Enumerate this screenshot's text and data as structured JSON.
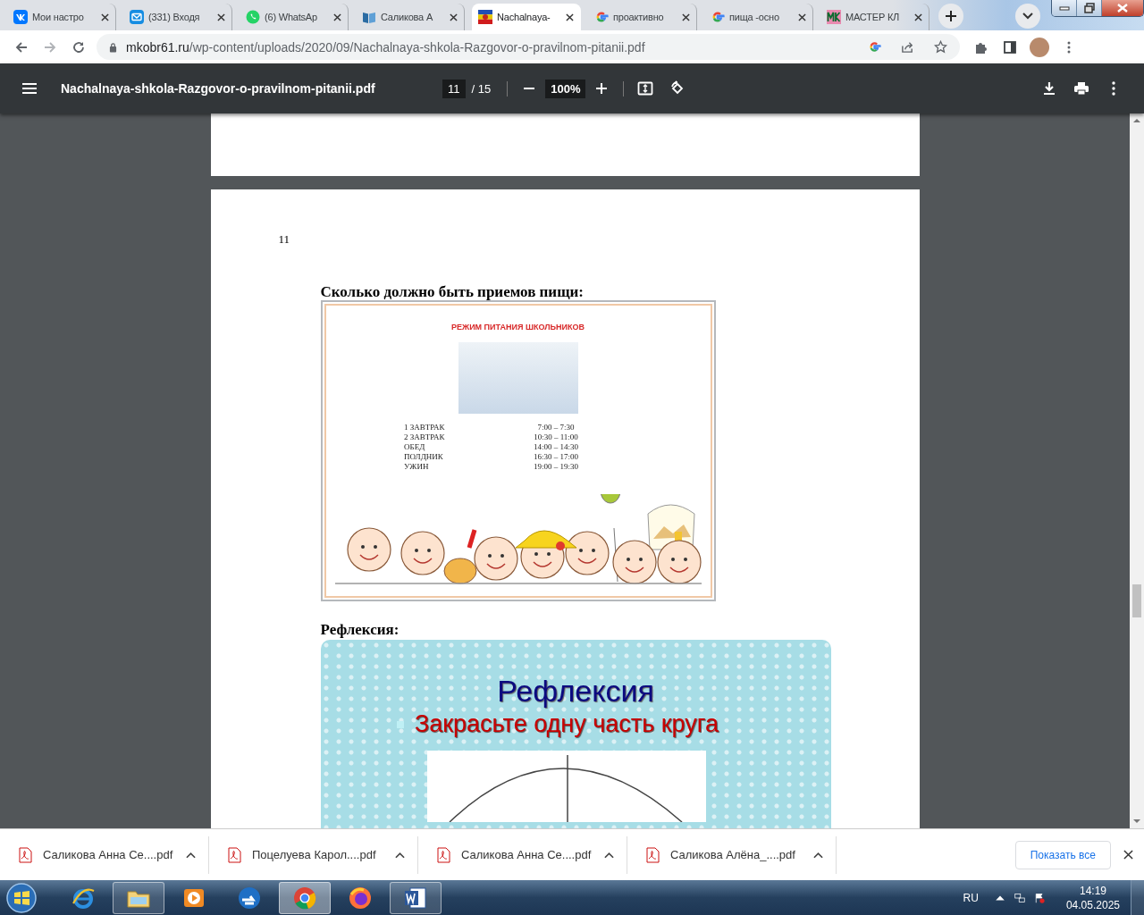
{
  "browser": {
    "tabs": [
      {
        "title": "Мои настро",
        "kind": "vk",
        "selected": false
      },
      {
        "title": "(331) Входя",
        "kind": "mail",
        "selected": false
      },
      {
        "title": "(6) WhatsAp",
        "kind": "whatsapp",
        "selected": false
      },
      {
        "title": "Саликова А",
        "kind": "book",
        "selected": false
      },
      {
        "title": "Nachalnaya-",
        "kind": "flag",
        "selected": true
      },
      {
        "title": "проактивно",
        "kind": "google",
        "selected": false
      },
      {
        "title": "пища -осно",
        "kind": "google",
        "selected": false
      },
      {
        "title": "МАСТЕР КЛ",
        "kind": "mk",
        "selected": false
      }
    ],
    "address": {
      "domain": "mkobr61.ru",
      "path": "/wp-content/uploads/2020/09/Nachalnaya-shkola-Razgovor-o-pravilnom-pitanii.pdf"
    }
  },
  "pdf_toolbar": {
    "filename": "Nachalnaya-shkola-Razgovor-o-pravilnom-pitanii.pdf",
    "page": "11",
    "page_total": "/ 15",
    "zoom": "100%"
  },
  "document": {
    "page_number": "11",
    "heading_meals": "Сколько должно быть приемов пищи:",
    "meal_slide": {
      "title": "РЕЖИМ ПИТАНИЯ ШКОЛЬНИКОВ",
      "meals": [
        {
          "name": "1 ЗАВТРАК",
          "time": "7:00 – 7:30"
        },
        {
          "name": "2 ЗАВТРАК",
          "time": "10:30 – 11:00"
        },
        {
          "name": "ОБЕД",
          "time": "14:00 – 14:30"
        },
        {
          "name": "ПОЛДНИК",
          "time": "16:30 – 17:00"
        },
        {
          "name": "УЖИН",
          "time": "19:00 – 19:30"
        }
      ]
    },
    "heading_reflection": "Рефлексия:",
    "reflection_slide": {
      "title": "Рефлексия",
      "bullet": "Закрасьте одну часть круга"
    }
  },
  "downloads": {
    "files": [
      "Саликова Анна Се....pdf",
      "Поцелуева Карол....pdf",
      "Саликова Анна Се....pdf",
      "Саликова Алёна_....pdf"
    ],
    "show_all": "Показать все"
  },
  "taskbar": {
    "apps": [
      {
        "kind": "ie",
        "running": false,
        "selected": false
      },
      {
        "kind": "explorer",
        "running": true,
        "selected": false
      },
      {
        "kind": "media",
        "running": false,
        "selected": false
      },
      {
        "kind": "arrow",
        "running": false,
        "selected": false
      },
      {
        "kind": "chrome",
        "running": true,
        "selected": true
      },
      {
        "kind": "firefox",
        "running": false,
        "selected": false
      },
      {
        "kind": "word",
        "running": true,
        "selected": false
      }
    ],
    "language": "RU",
    "time": "14:19",
    "date": "04.05.2025"
  }
}
